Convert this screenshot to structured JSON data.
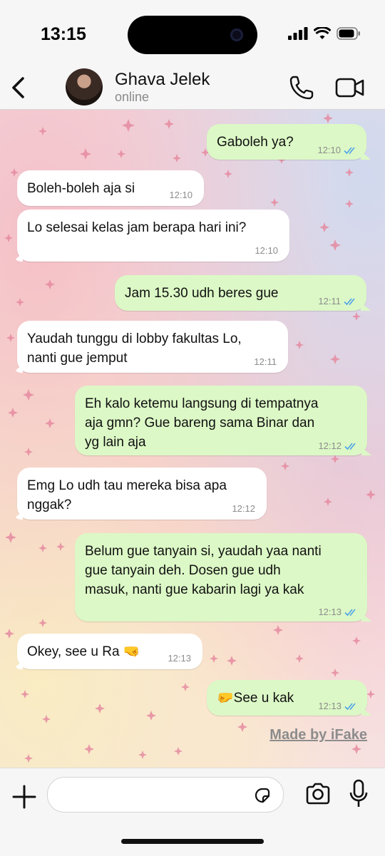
{
  "status_bar": {
    "time": "13:15"
  },
  "header": {
    "name": "Ghava Jelek",
    "status": "online"
  },
  "messages": [
    {
      "dir": "out",
      "text": "Gaboleh ya?",
      "time": "12:10"
    },
    {
      "dir": "in",
      "text": "Boleh-boleh aja si",
      "time": "12:10"
    },
    {
      "dir": "in",
      "text": "Lo selesai kelas jam berapa hari ini?",
      "time": "12:10"
    },
    {
      "dir": "out",
      "text": "Jam 15.30 udh beres gue",
      "time": "12:11"
    },
    {
      "dir": "in",
      "text": "Yaudah tunggu di lobby fakultas Lo,\nnanti gue jemput",
      "time": "12:11"
    },
    {
      "dir": "out",
      "text": "Eh kalo ketemu langsung di tempatnya\naja gmn? Gue bareng sama Binar dan\nyg lain aja",
      "time": "12:12"
    },
    {
      "dir": "in",
      "text": "Emg Lo udh tau mereka bisa apa\nnggak?",
      "time": "12:12"
    },
    {
      "dir": "out",
      "text": "Belum gue tanyain si, yaudah yaa nanti\ngue tanyain deh. Dosen gue udh\nmasuk, nanti gue kabarin lagi ya kak",
      "time": "12:13"
    },
    {
      "dir": "in",
      "text": "Okey, see u Ra 🤜",
      "time": "12:13"
    },
    {
      "dir": "out",
      "text": "🤛See u kak",
      "time": "12:13"
    }
  ],
  "watermark": "Made by iFake",
  "colors": {
    "outgoing_bubble": "#dcf8c6",
    "incoming_bubble": "#ffffff",
    "read_ticks": "#4fa3e8"
  },
  "icons": [
    "back-arrow-icon",
    "phone-icon",
    "video-call-icon",
    "plus-icon",
    "sticker-icon",
    "camera-icon",
    "mic-icon",
    "double-check-icon"
  ]
}
